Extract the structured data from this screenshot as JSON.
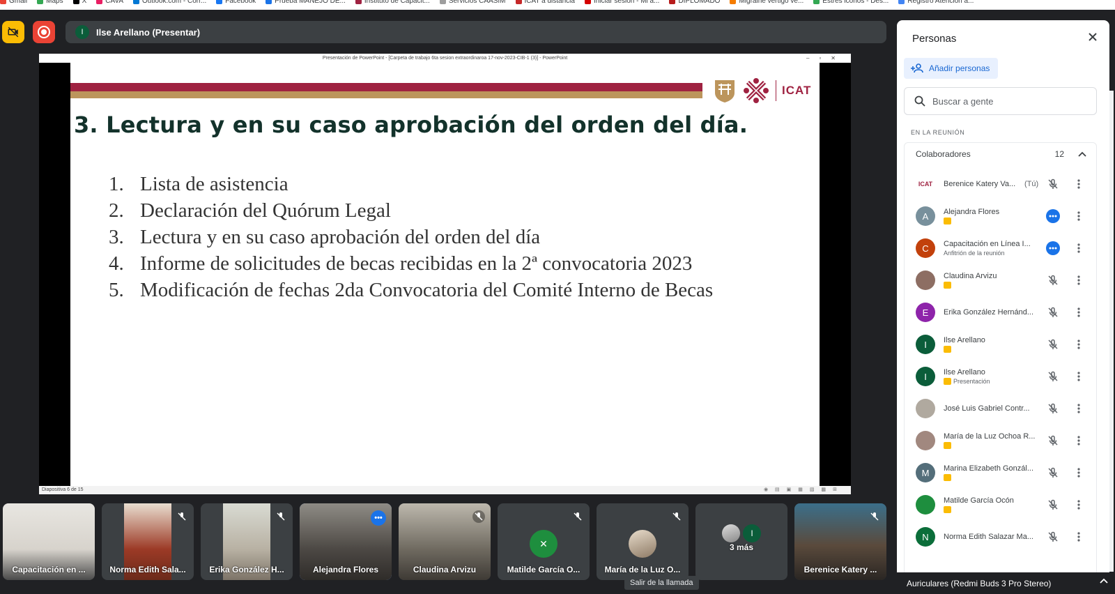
{
  "bookmarks": [
    "Gmail",
    "Maps",
    "X",
    "CAVA",
    "Outlook.com - Corr...",
    "Facebook",
    "Prueba MANEJO DE...",
    "Instituto de Capacit...",
    "Servicios CAASIM",
    "ICAT a distancia",
    "Iniciar sesión - Mi a...",
    "DIPLOMADO",
    "Migraine vertigo ve...",
    "Estres iconos - Des...",
    "Registro Atención a..."
  ],
  "presenter": {
    "initial": "I",
    "label": "Ilse Arellano (Presentar)"
  },
  "ppt": {
    "window_title": "Presentación de PowerPoint - [Carpeta de trabajo 6ta sesion extraordinaroa 17-nov-2023-CIB-1 (3)] - PowerPoint",
    "status": "Diapositiva 6 de 15",
    "slide": {
      "title": "3. Lectura y en su caso aprobación del orden del día.",
      "logo_text": "ICAT",
      "items": [
        {
          "num": "1.",
          "text": "Lista de asistencia"
        },
        {
          "num": "2.",
          "text": "Declaración del Quórum Legal"
        },
        {
          "num": "3.",
          "text": "Lectura y en su caso aprobación del orden del día"
        },
        {
          "num": "4.",
          "text": "Informe de solicitudes de becas recibidas en la 2ª convocatoria 2023"
        },
        {
          "num": "5.",
          "text": "Modificación de fechas 2da Convocatoria del Comité Interno de Becas"
        }
      ]
    }
  },
  "tiles": [
    {
      "name": "Capacitación en ..."
    },
    {
      "name": "Norma Edith Sala..."
    },
    {
      "name": "Erika González H..."
    },
    {
      "name": "Alejandra Flores"
    },
    {
      "name": "Claudina Arvizu"
    },
    {
      "name": "Matilde García O..."
    },
    {
      "name": "María de la Luz O..."
    },
    {
      "name": "3 más",
      "initial": "I"
    },
    {
      "name": "Berenice Katery ..."
    }
  ],
  "tooltip": "Salir de la llamada",
  "panel": {
    "title": "Personas",
    "add_label": "Añadir personas",
    "search_placeholder": "Buscar a gente",
    "section_label": "EN LA REUNIÓN",
    "group_label": "Colaboradores",
    "group_count": "12",
    "people": [
      {
        "initial": "ICAT",
        "name": "Berenice Katery Va...",
        "tu": "(Tú)",
        "sub": "",
        "avatar_color": "#ffffff"
      },
      {
        "initial": "A",
        "name": "Alejandra Flores",
        "sub": "",
        "avatar_color": "#78909c"
      },
      {
        "initial": "C",
        "name": "Capacitación en Línea I...",
        "sub": "Anfitrión de la reunión",
        "avatar_color": "#c2410c"
      },
      {
        "initial": "",
        "name": "Claudina Arvizu",
        "sub": "",
        "avatar_color": "#8d6e63"
      },
      {
        "initial": "E",
        "name": "Erika González Hernánd...",
        "sub": "",
        "avatar_color": "#8e24aa"
      },
      {
        "initial": "I",
        "name": "Ilse Arellano",
        "sub": "",
        "avatar_color": "#0b5d3a"
      },
      {
        "initial": "I",
        "name": "Ilse Arellano",
        "sub": "Presentación",
        "avatar_color": "#0b5d3a"
      },
      {
        "initial": "",
        "name": "José Luis Gabriel Contr...",
        "sub": "",
        "avatar_color": "#b0a99f"
      },
      {
        "initial": "",
        "name": "María de la Luz Ochoa R...",
        "sub": "",
        "avatar_color": "#a1887f"
      },
      {
        "initial": "M",
        "name": "Marina Elizabeth Gonzál...",
        "sub": "",
        "avatar_color": "#546e7a"
      },
      {
        "initial": "",
        "name": "Matilde García Ocón",
        "sub": "",
        "avatar_color": "#1e8e3e"
      },
      {
        "initial": "N",
        "name": "Norma Edith Salazar Ma...",
        "sub": "",
        "avatar_color": "#0b6e3a"
      }
    ]
  },
  "audio_device": "Auriculares (Redmi Buds 3 Pro Stereo)",
  "colors": {
    "accent": "#1a73e8",
    "slide_red": "#9f2241",
    "slide_gold": "#bc955c",
    "dark_bg": "#202124"
  }
}
